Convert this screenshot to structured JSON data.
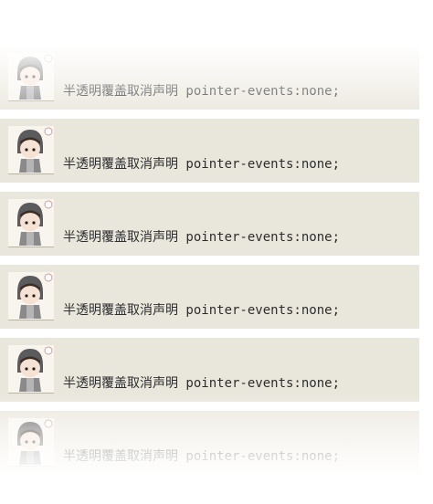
{
  "list": {
    "items": [
      {
        "text": "半透明覆盖取消声明 pointer-events:none;",
        "avatar": "avatar-icon"
      },
      {
        "text": "半透明覆盖取消声明 pointer-events:none;",
        "avatar": "avatar-icon"
      },
      {
        "text": "半透明覆盖取消声明 pointer-events:none;",
        "avatar": "avatar-icon"
      },
      {
        "text": "半透明覆盖取消声明 pointer-events:none;",
        "avatar": "avatar-icon"
      },
      {
        "text": "半透明覆盖取消声明 pointer-events:none;",
        "avatar": "avatar-icon"
      },
      {
        "text": "半透明覆盖取消声明 pointer-events:none;",
        "avatar": "avatar-icon"
      }
    ]
  },
  "colors": {
    "row_background": "#e9e6db",
    "text": "#2d2d2d",
    "overlay": "#ffffff"
  }
}
